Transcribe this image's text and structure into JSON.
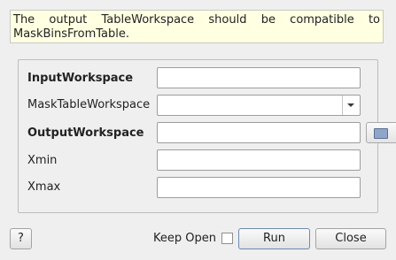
{
  "note": "The output TableWorkspace should be compatible to MaskBinsFromTable.",
  "form": {
    "input_workspace": {
      "label": "InputWorkspace",
      "value": ""
    },
    "mask_table_workspace": {
      "label": "MaskTableWorkspace",
      "value": ""
    },
    "output_workspace": {
      "label": "OutputWorkspace",
      "value": ""
    },
    "xmin": {
      "label": "Xmin",
      "value": ""
    },
    "xmax": {
      "label": "Xmax",
      "value": ""
    }
  },
  "footer": {
    "help_label": "?",
    "keep_open_label": "Keep Open",
    "keep_open_checked": false,
    "run_label": "Run",
    "close_label": "Close"
  },
  "icons": {
    "combo": "chevron-down-icon",
    "browse": "folder-icon"
  }
}
